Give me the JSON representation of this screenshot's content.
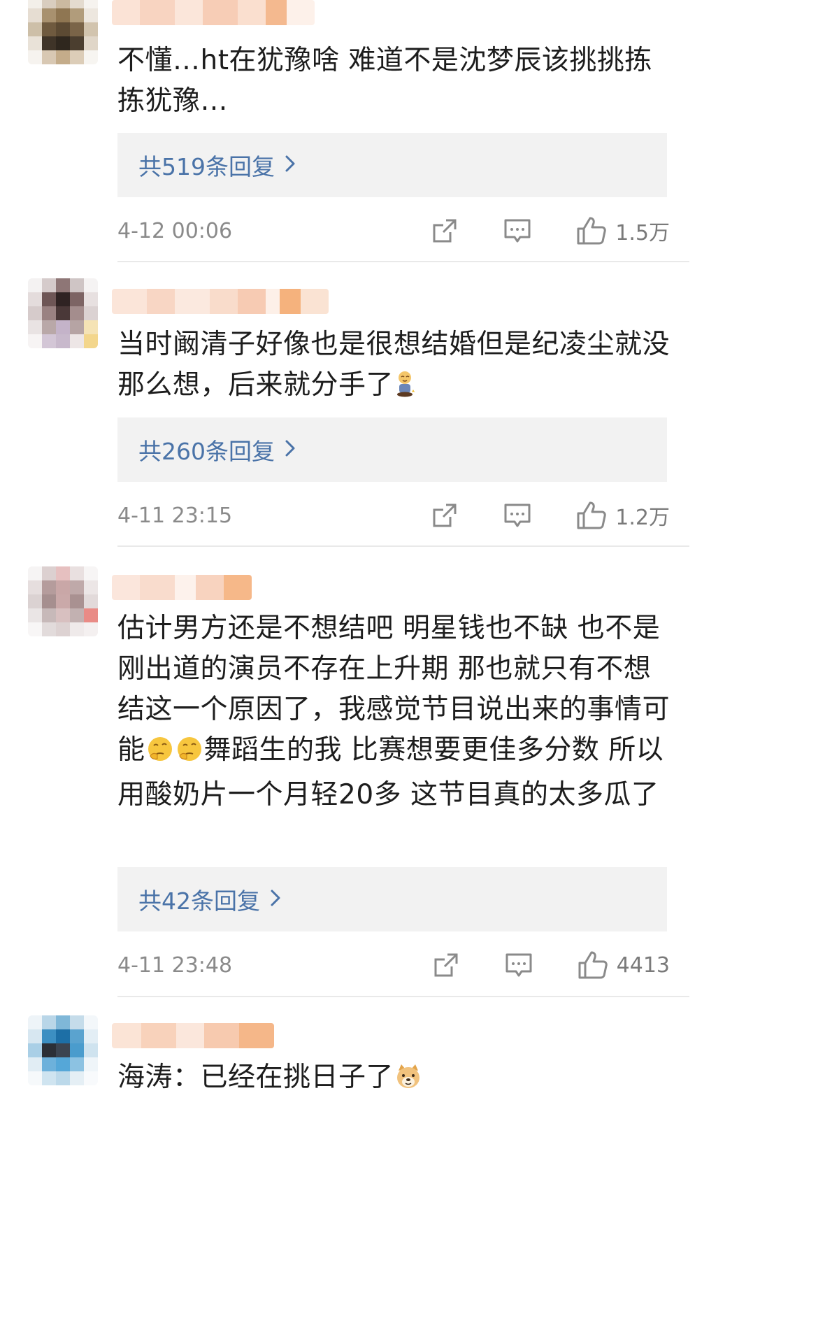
{
  "comments": [
    {
      "text": "不懂…ht在犹豫啥 难道不是沈梦辰该挑挑拣拣犹豫…",
      "emoji": "",
      "replies": "共519条回复",
      "date": "4-12 00:06",
      "likes": "1.5万"
    },
    {
      "text": "当时阚清子好像也是很想结婚但是纪凌尘就没那么想，后来就分手了",
      "emoji": "sitting-figure-emoji",
      "replies": "共260条回复",
      "date": "4-11 23:15",
      "likes": "1.2万"
    },
    {
      "text_before_emoji": "估计男方还是不想结吧 明星钱也不缺 也不是刚出道的演员不存在上升期 那也就只有不想结这一个原因了，我感觉节目说出来的事情可能",
      "emoji": "thinking-face-emoji x2",
      "text_after_emoji": "舞蹈生的我 比赛想要更佳多分数 所以用酸奶片一个月轻20多 这节目真的太多瓜了",
      "replies": "共42条回复",
      "date": "4-11 23:48",
      "likes": "4413"
    },
    {
      "text": "海涛：已经在挑日子了",
      "emoji": "doge-emoji"
    }
  ],
  "icons": {
    "share": "share-icon",
    "comment": "comment-icon",
    "like": "thumbs-up-icon",
    "chevron": "chevron-right-icon"
  },
  "colors": {
    "reply_link": "#4a73a8",
    "reply_bg": "#f2f2f2",
    "meta_text": "#8a8a8a"
  }
}
